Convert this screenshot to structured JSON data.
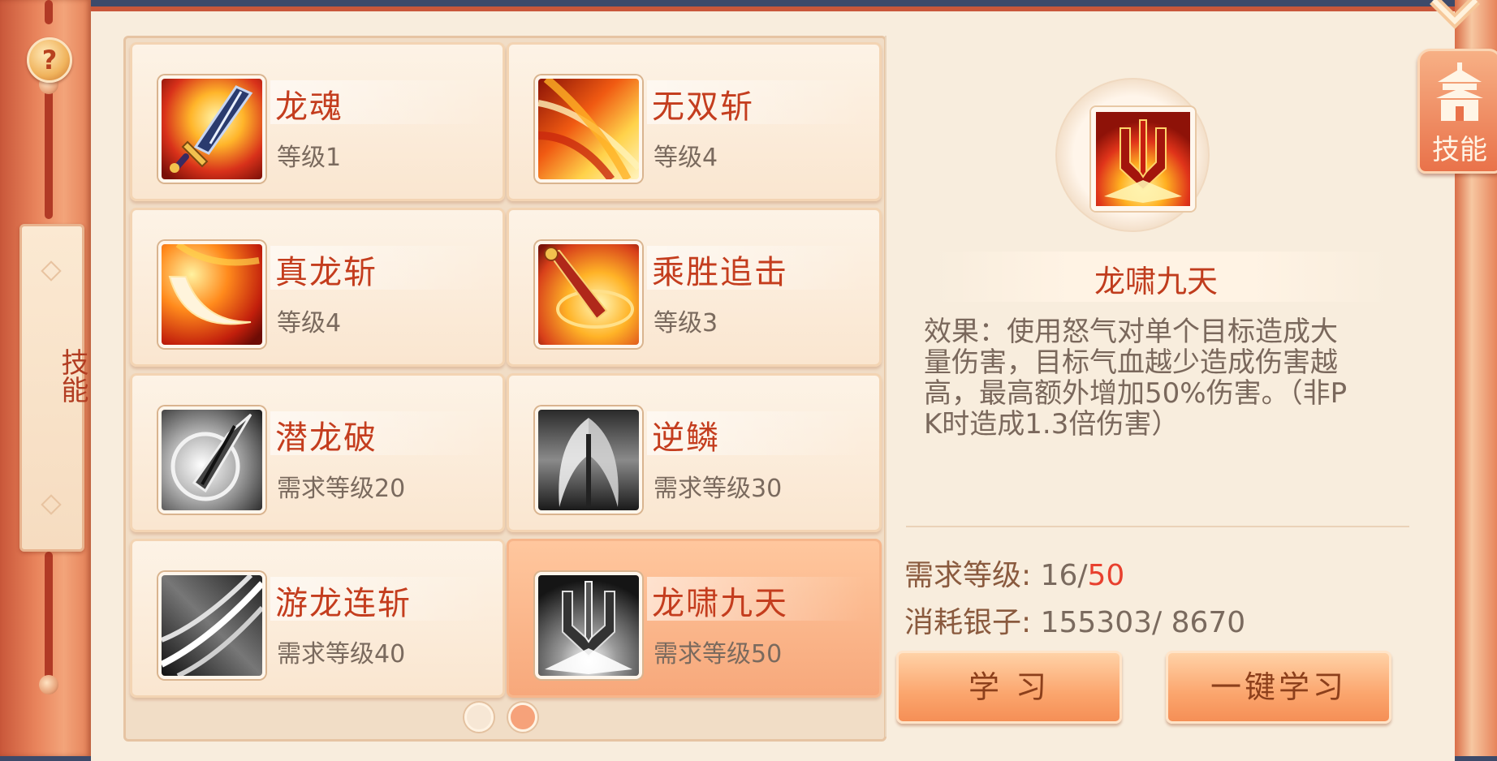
{
  "left_sidebar": {
    "help_label": "?",
    "tab_label": "技能"
  },
  "skills": [
    {
      "name": "龙魂",
      "level": "等级1",
      "style": "fire-sword",
      "selected": false
    },
    {
      "name": "无双斩",
      "level": "等级4",
      "style": "fire-slash",
      "selected": false
    },
    {
      "name": "真龙斩",
      "level": "等级4",
      "style": "fire-crescent",
      "selected": false
    },
    {
      "name": "乘胜追击",
      "level": "等级3",
      "style": "fire-dagger",
      "selected": false
    },
    {
      "name": "潜龙破",
      "level": "需求等级20",
      "style": "grey-swirl",
      "selected": false
    },
    {
      "name": "逆鳞",
      "level": "需求等级30",
      "style": "grey-wings",
      "selected": false
    },
    {
      "name": "游龙连斩",
      "level": "需求等级40",
      "style": "grey-slash",
      "selected": false
    },
    {
      "name": "龙啸九天",
      "level": "需求等级50",
      "style": "grey-trident",
      "selected": true
    }
  ],
  "pagination": {
    "pages": 2,
    "current": 2
  },
  "detail": {
    "title": "龙啸九天",
    "description": "效果：使用怒气对单个目标造成大量伤害，目标气血越少造成伤害越高，最高额外增加50%伤害。（非PK时造成1.3倍伤害）",
    "req_level_label": "需求等级:",
    "req_level_current": "16/",
    "req_level_required": "50",
    "silver_label": "消耗银子:",
    "silver_value": "155303/ 8670",
    "learn_button": "学 习",
    "learn_all_button": "一键学习"
  },
  "right_tab": {
    "label": "技能"
  },
  "colors": {
    "accent_red": "#c43d1e",
    "warning_red": "#e8402e",
    "button_orange": "#fba56d",
    "panel_bg": "#f8eddd"
  }
}
